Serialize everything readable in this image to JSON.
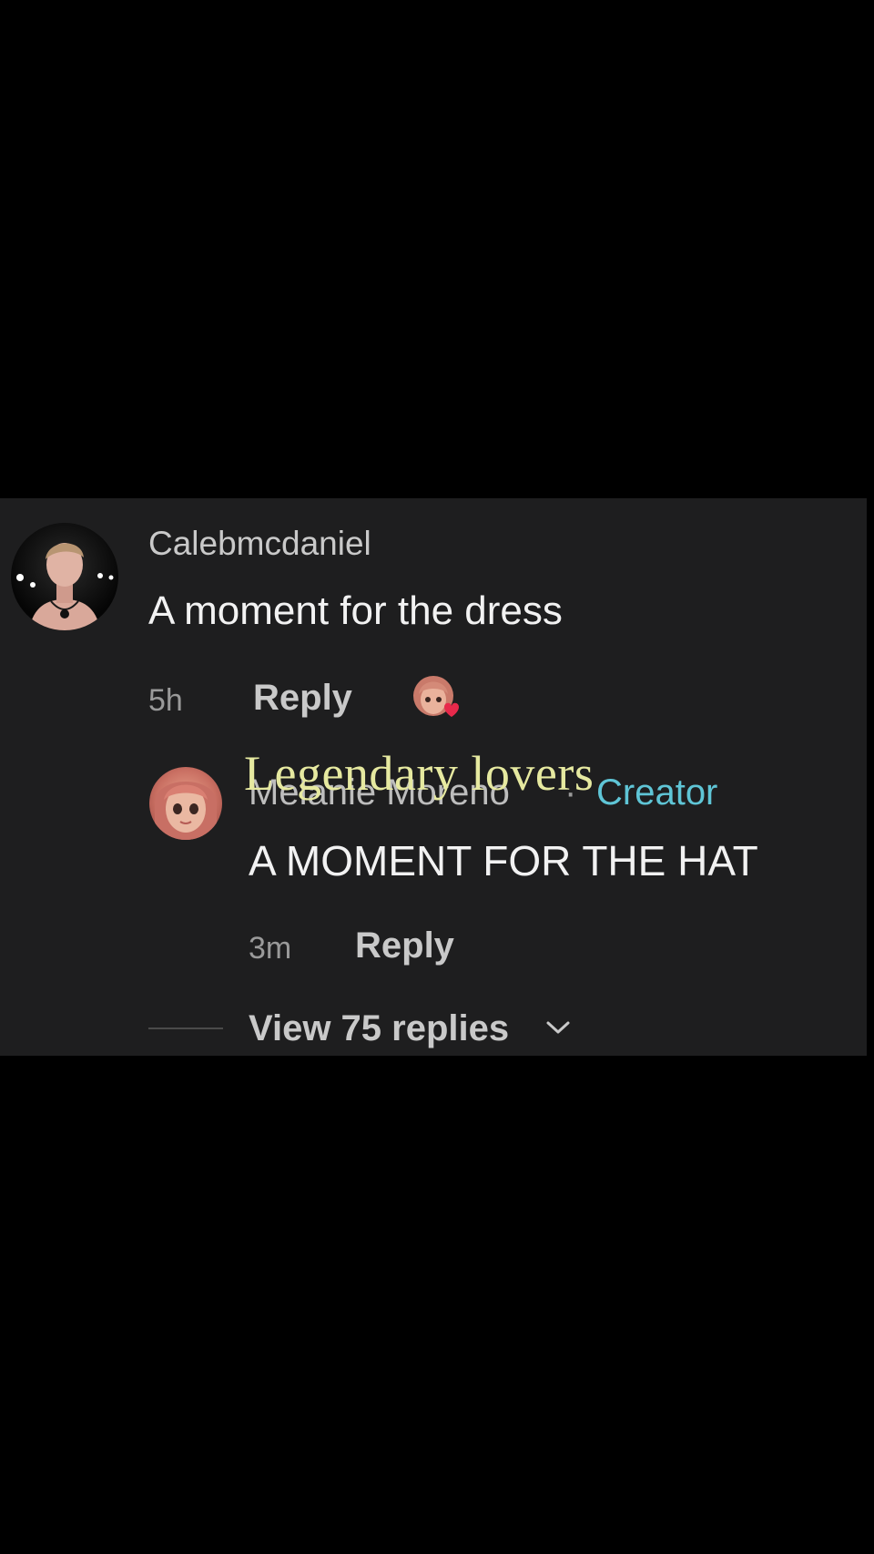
{
  "comment": {
    "username": "Calebmcdaniel",
    "text": "A moment for the dress",
    "time": "5h",
    "reply_label": "Reply"
  },
  "reply": {
    "username": "Melanie Moreno",
    "separator": "·",
    "badge": "Creator",
    "text": "A MOMENT FOR THE HAT",
    "time": "3m",
    "reply_label": "Reply"
  },
  "thread": {
    "view_replies_label": "View 75 replies"
  },
  "overlay": {
    "caption": "Legendary lovers"
  },
  "colors": {
    "background": "#000000",
    "panel": "#1e1e1f",
    "creator_badge": "#5fc5d6",
    "caption": "#e6e9a0",
    "heart": "#e8294b"
  },
  "icons": {
    "liked_by_creator": "heart-avatar-icon",
    "expand": "chevron-down-icon"
  }
}
